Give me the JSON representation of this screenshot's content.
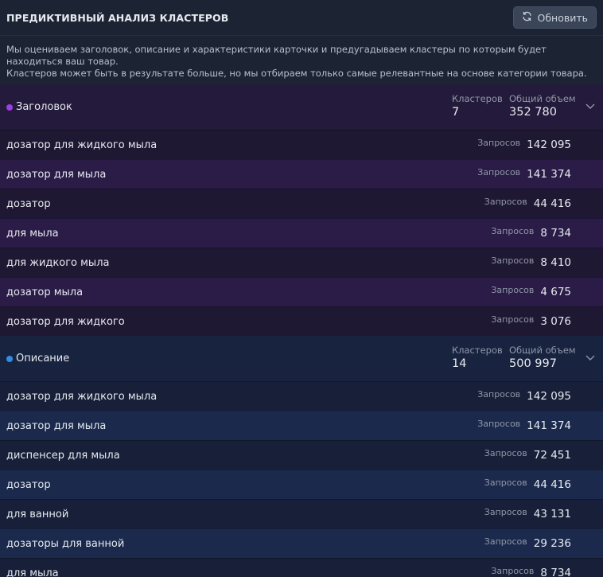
{
  "header": {
    "title": "ПРЕДИКТИВНЫЙ АНАЛИЗ КЛАСТЕРОВ",
    "refresh_label": "Обновить"
  },
  "description": {
    "line1": "Мы оцениваем заголовок, описание и характеристики карточки и предугадываем кластеры по которым будет находиться ваш товар.",
    "line2": "Кластеров может быть в результате больше, но мы отбираем только самые релевантные на основе категории товара."
  },
  "colors": {
    "title_dot": "#9b3fe0",
    "description_dot": "#2f8fe6"
  },
  "groups": [
    {
      "name": "Заголовок",
      "clusters_label": "Кластеров",
      "clusters": "7",
      "volume_label": "Общий объем",
      "volume": "352 780",
      "rows": [
        {
          "text": "дозатор для жидкого мыла",
          "qlabel": "Запросов",
          "q": "142 095"
        },
        {
          "text": "дозатор для мыла",
          "qlabel": "Запросов",
          "q": "141 374"
        },
        {
          "text": "дозатор",
          "qlabel": "Запросов",
          "q": "44 416"
        },
        {
          "text": "для мыла",
          "qlabel": "Запросов",
          "q": "8 734"
        },
        {
          "text": "для жидкого мыла",
          "qlabel": "Запросов",
          "q": "8 410"
        },
        {
          "text": "дозатор мыла",
          "qlabel": "Запросов",
          "q": "4 675"
        },
        {
          "text": "дозатор для жидкого",
          "qlabel": "Запросов",
          "q": "3 076"
        }
      ]
    },
    {
      "name": "Описание",
      "clusters_label": "Кластеров",
      "clusters": "14",
      "volume_label": "Общий объем",
      "volume": "500 997",
      "rows": [
        {
          "text": "дозатор для жидкого мыла",
          "qlabel": "Запросов",
          "q": "142 095"
        },
        {
          "text": "дозатор для мыла",
          "qlabel": "Запросов",
          "q": "141 374"
        },
        {
          "text": "диспенсер для мыла",
          "qlabel": "Запросов",
          "q": "72 451"
        },
        {
          "text": "дозатор",
          "qlabel": "Запросов",
          "q": "44 416"
        },
        {
          "text": "для ванной",
          "qlabel": "Запросов",
          "q": "43 131"
        },
        {
          "text": "дозаторы для ванной",
          "qlabel": "Запросов",
          "q": "29 236"
        },
        {
          "text": "для мыла",
          "qlabel": "Запросов",
          "q": "8 734"
        }
      ]
    }
  ]
}
